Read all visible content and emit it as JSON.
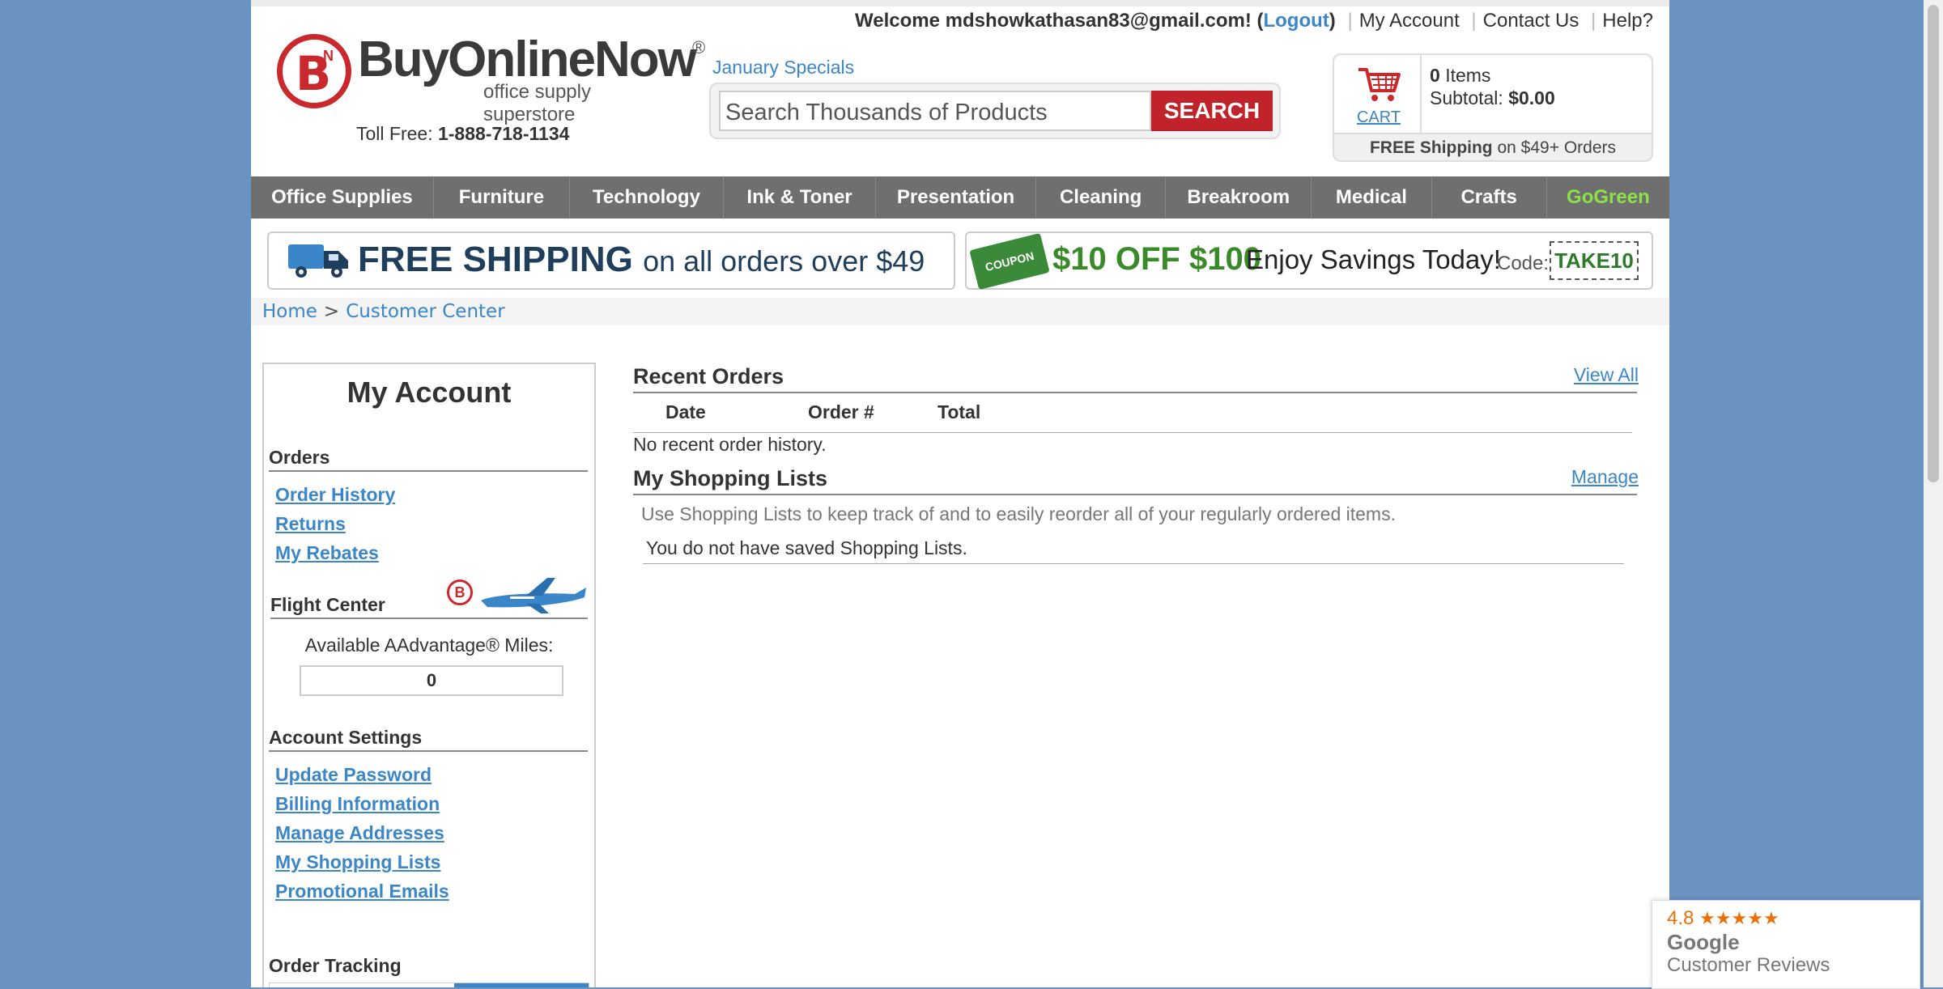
{
  "header": {
    "welcome_prefix": "Welcome mdshowkathasan83@gmail.com! (",
    "logout": "Logout",
    "welcome_suffix": ")",
    "my_account": "My Account",
    "contact_us": "Contact Us",
    "help": "Help?",
    "brand": "BuyOnlineNow",
    "brand_mark": "B",
    "brand_mark_small": "N",
    "registered": "®",
    "tagline": "office supply superstore",
    "toll_free_label": "Toll Free:",
    "toll_free_number": "1-888-718-1134",
    "specials_link": "January Specials",
    "search_placeholder": "Search Thousands of Products",
    "search_button": "SEARCH"
  },
  "cart": {
    "label": "CART",
    "items_count": "0",
    "items_label": "Items",
    "subtotal_label": "Subtotal:",
    "subtotal_value": "$0.00",
    "free_shipping_bold": "FREE Shipping",
    "free_shipping_rest": "on $49+ Orders"
  },
  "nav": {
    "items": [
      "Office Supplies",
      "Furniture",
      "Technology",
      "Ink & Toner",
      "Presentation",
      "Cleaning",
      "Breakroom",
      "Medical",
      "Crafts",
      "GoGreen"
    ]
  },
  "banners": {
    "shipping_bold": "FREE SHIPPING",
    "shipping_rest": "on all orders over $49",
    "coupon_tag": "COUPON",
    "offer": "$10 OFF $100",
    "enjoy": "Enjoy Savings Today!",
    "code_label": "Code:",
    "code": "TAKE10"
  },
  "breadcrumb": {
    "home": "Home",
    "separator": ">",
    "current": "Customer Center"
  },
  "sidebar": {
    "title": "My Account",
    "orders_heading": "Orders",
    "order_links": [
      "Order History",
      "Returns",
      "My Rebates"
    ],
    "flight_heading": "Flight Center",
    "flight_logo": "B",
    "miles_label": "Available AAdvantage® Miles:",
    "miles_value": "0",
    "settings_heading": "Account Settings",
    "settings_links": [
      "Update Password",
      "Billing Information",
      "Manage Addresses",
      "My Shopping Lists",
      "Promotional Emails"
    ],
    "tracking_heading": "Order Tracking"
  },
  "main": {
    "recent_orders_title": "Recent Orders",
    "view_all": "View All",
    "columns": [
      "Date",
      "Order #",
      "Total"
    ],
    "no_orders": "No recent order history.",
    "shopping_lists_title": "My Shopping Lists",
    "manage": "Manage",
    "lists_hint": "Use Shopping Lists to keep track of and to easily reorder all of your regularly ordered items.",
    "no_lists": "You do not have saved Shopping Lists."
  },
  "google_badge": {
    "rating": "4.8",
    "stars": "★★★★★",
    "brand": "Google",
    "label": "Customer Reviews"
  }
}
